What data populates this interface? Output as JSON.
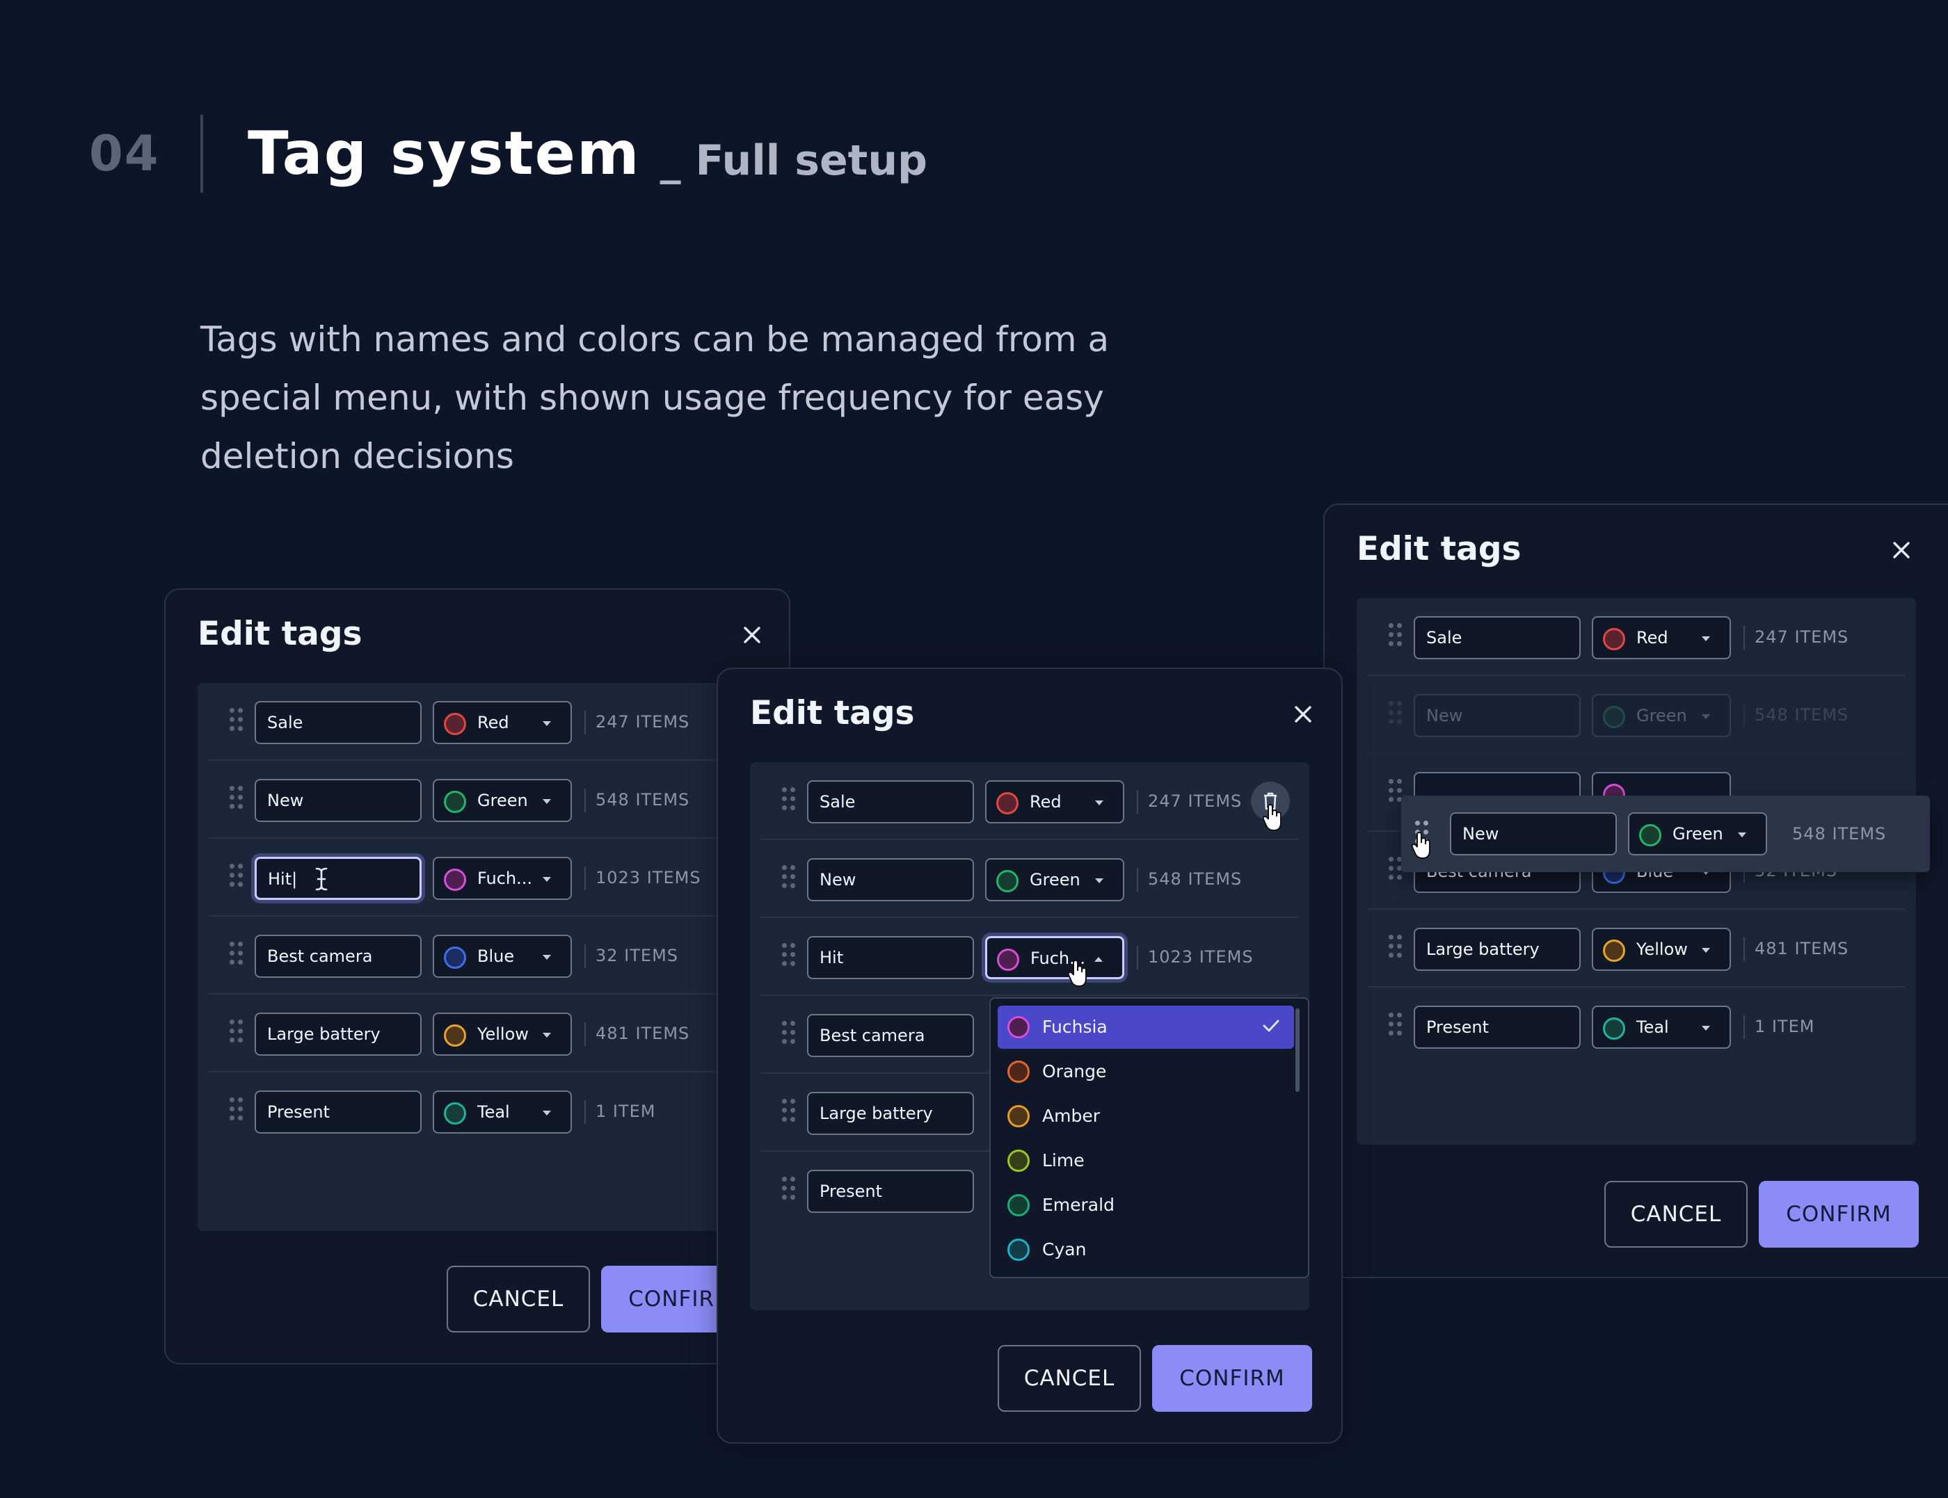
{
  "header": {
    "number": "04",
    "title": "Tag system",
    "subtitle": "_ Full setup",
    "description": "Tags with names and colors can be managed from a special menu, with shown usage frequency for easy deletion decisions"
  },
  "colors": {
    "background": "#0d1528",
    "accent": "#8b8cf8",
    "red": "#e0483f",
    "green": "#22b469",
    "fuchsia": "#d64fd6",
    "blue": "#3e6fe5",
    "yellow": "#e8a32a",
    "teal": "#1fb39a",
    "orange": "#e0662a",
    "amber": "#e89a2a",
    "lime": "#9bc425",
    "emerald": "#19ad78",
    "cyan": "#1fb1c9"
  },
  "modal1": {
    "title": "Edit tags",
    "cancel": "CANCEL",
    "confirm": "CONFIRM",
    "rows": [
      {
        "name": "Sale",
        "color": "Red",
        "count": "247 ITEMS"
      },
      {
        "name": "New",
        "color": "Green",
        "count": "548 ITEMS"
      },
      {
        "name": "Hit|",
        "color": "Fuch...",
        "count": "1023 ITEMS"
      },
      {
        "name": "Best camera",
        "color": "Blue",
        "count": "32 ITEMS"
      },
      {
        "name": "Large battery",
        "color": "Yellow",
        "count": "481 ITEMS"
      },
      {
        "name": "Present",
        "color": "Teal",
        "count": "1 ITEM"
      }
    ]
  },
  "modal2": {
    "title": "Edit tags",
    "cancel": "CANCEL",
    "confirm": "CONFIRM",
    "rows": [
      {
        "name": "Sale",
        "color": "Red",
        "count": "247 ITEMS"
      },
      {
        "name": "New",
        "color": "Green",
        "count": "548 ITEMS"
      },
      {
        "name": "Hit",
        "color": "Fuch...",
        "count": "1023 ITEMS"
      },
      {
        "name": "Best camera"
      },
      {
        "name": "Large battery"
      },
      {
        "name": "Present"
      }
    ],
    "dropdown": [
      "Fuchsia",
      "Orange",
      "Amber",
      "Lime",
      "Emerald",
      "Cyan"
    ]
  },
  "modal3": {
    "title": "Edit tags",
    "cancel": "CANCEL",
    "confirm": "CONFIRM",
    "rows": [
      {
        "name": "Sale",
        "color": "Red",
        "count": "247 ITEMS"
      },
      {
        "name": "New",
        "color": "Green",
        "count": "548 ITEMS"
      },
      {
        "name": "Best camera",
        "color": "Blue",
        "count": "32 ITEMS"
      },
      {
        "name": "Large battery",
        "color": "Yellow",
        "count": "481 ITEMS"
      },
      {
        "name": "Present",
        "color": "Teal",
        "count": "1 ITEM"
      }
    ],
    "dragged": {
      "name": "New",
      "color": "Green",
      "count": "548 ITEMS"
    }
  }
}
